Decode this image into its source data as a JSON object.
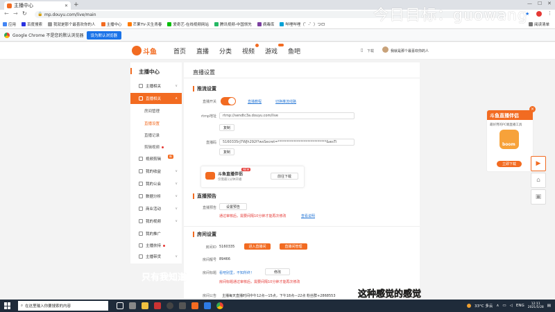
{
  "browser": {
    "tab_title": "主播中心",
    "url": "mp.douyu.com/live/main",
    "bookmarks": [
      "应用",
      "百度搜索",
      "我就是那个最喜欢你的人",
      "主播中心",
      "芒果TV-天生青春",
      "爱奇艺-在线视频网站",
      "腾讯视频-中国领先",
      "病毒库",
      "哔哩哔哩（゜-゜）つロ"
    ],
    "reading_list": "阅读清单",
    "infobar_text": "Google Chrome 不是您的默认浏览器",
    "infobar_button": "设为默认浏览器"
  },
  "overlay": {
    "goal_text": "今日目标：guowang",
    "caption_left": "只有我知道",
    "caption_right": "这种感觉的感觉"
  },
  "site": {
    "logo_text": "斗鱼",
    "nav": [
      "首页",
      "直播",
      "分类",
      "视频",
      "游戏",
      "鱼吧"
    ],
    "download": "下载",
    "username": "我就是那个最喜欢你的人"
  },
  "sidebar": {
    "title": "主播中心",
    "items": [
      {
        "label": "主播相关"
      },
      {
        "label": "直播相关",
        "active": true
      },
      {
        "label": "房间管理",
        "sub": true
      },
      {
        "label": "直播设置",
        "sub": true,
        "selected": true
      },
      {
        "label": "直播记录",
        "sub": true
      },
      {
        "label": "剪辑视频",
        "sub": true
      },
      {
        "label": "视频剪辑"
      },
      {
        "label": "我的收益"
      },
      {
        "label": "我的公会"
      },
      {
        "label": "数据分析"
      },
      {
        "label": "商业活动"
      },
      {
        "label": "我的视频"
      },
      {
        "label": "我的推广"
      },
      {
        "label": "主播扶持"
      },
      {
        "label": "主播带货"
      }
    ],
    "badge_text": "新"
  },
  "main": {
    "page_title": "直播设置",
    "stream": {
      "title": "推流设置",
      "switch_label": "直播开关",
      "link1": "直播教程",
      "link2": "切换推流线路",
      "rtmp_label": "rtmp地址",
      "rtmp_value": "rtmp://sendtc3a.douyu.com/live",
      "copy": "复制",
      "code_label": "直播码",
      "code_value": "5160335rJ7WJh292f?wsSecret=****************************&wsTi"
    },
    "promo": {
      "title": "斗鱼直播伴侣",
      "subtitle": "仅需最1分钟开播",
      "badge": "NEW",
      "button": "前往下载"
    },
    "preview": {
      "title": "直播预告",
      "label": "直播预告",
      "button": "设置预告",
      "warn": "通过审核后，需要间隔10分钟才能再次修改",
      "link": "查看说明"
    },
    "room": {
      "title": "房间设置",
      "id_label": "房间ID",
      "id_value": "5160335",
      "enter_room": "进入直播间",
      "room_manage": "直播间管理",
      "num_label": "房间靓号",
      "num_value": "89466",
      "title_label": "房间标题",
      "title_value": "看吧别里，不知所终！",
      "modify": "修改",
      "title_warn": "房间标题通过审核后，需要间隔10分钟才能再次修改",
      "notice_label": "房间公告",
      "notice_value": "主播每天直播时间中午12点—15点，下午18点—22点 粉丝群+2868553"
    }
  },
  "right_promo": {
    "title": "斗鱼直播伴侣",
    "subtitle": "最好用的PC端直播工具",
    "brand": "boom",
    "button": "立即下载"
  },
  "taskbar": {
    "search_placeholder": "在这里输入你要搜索的内容",
    "weather": "33°C 多云",
    "lang": "ENG",
    "time": "12:11",
    "date": "2021/5/28"
  },
  "colors": {
    "accent": "#f26b21",
    "link": "#2e7cd7",
    "warn": "#e53935"
  }
}
